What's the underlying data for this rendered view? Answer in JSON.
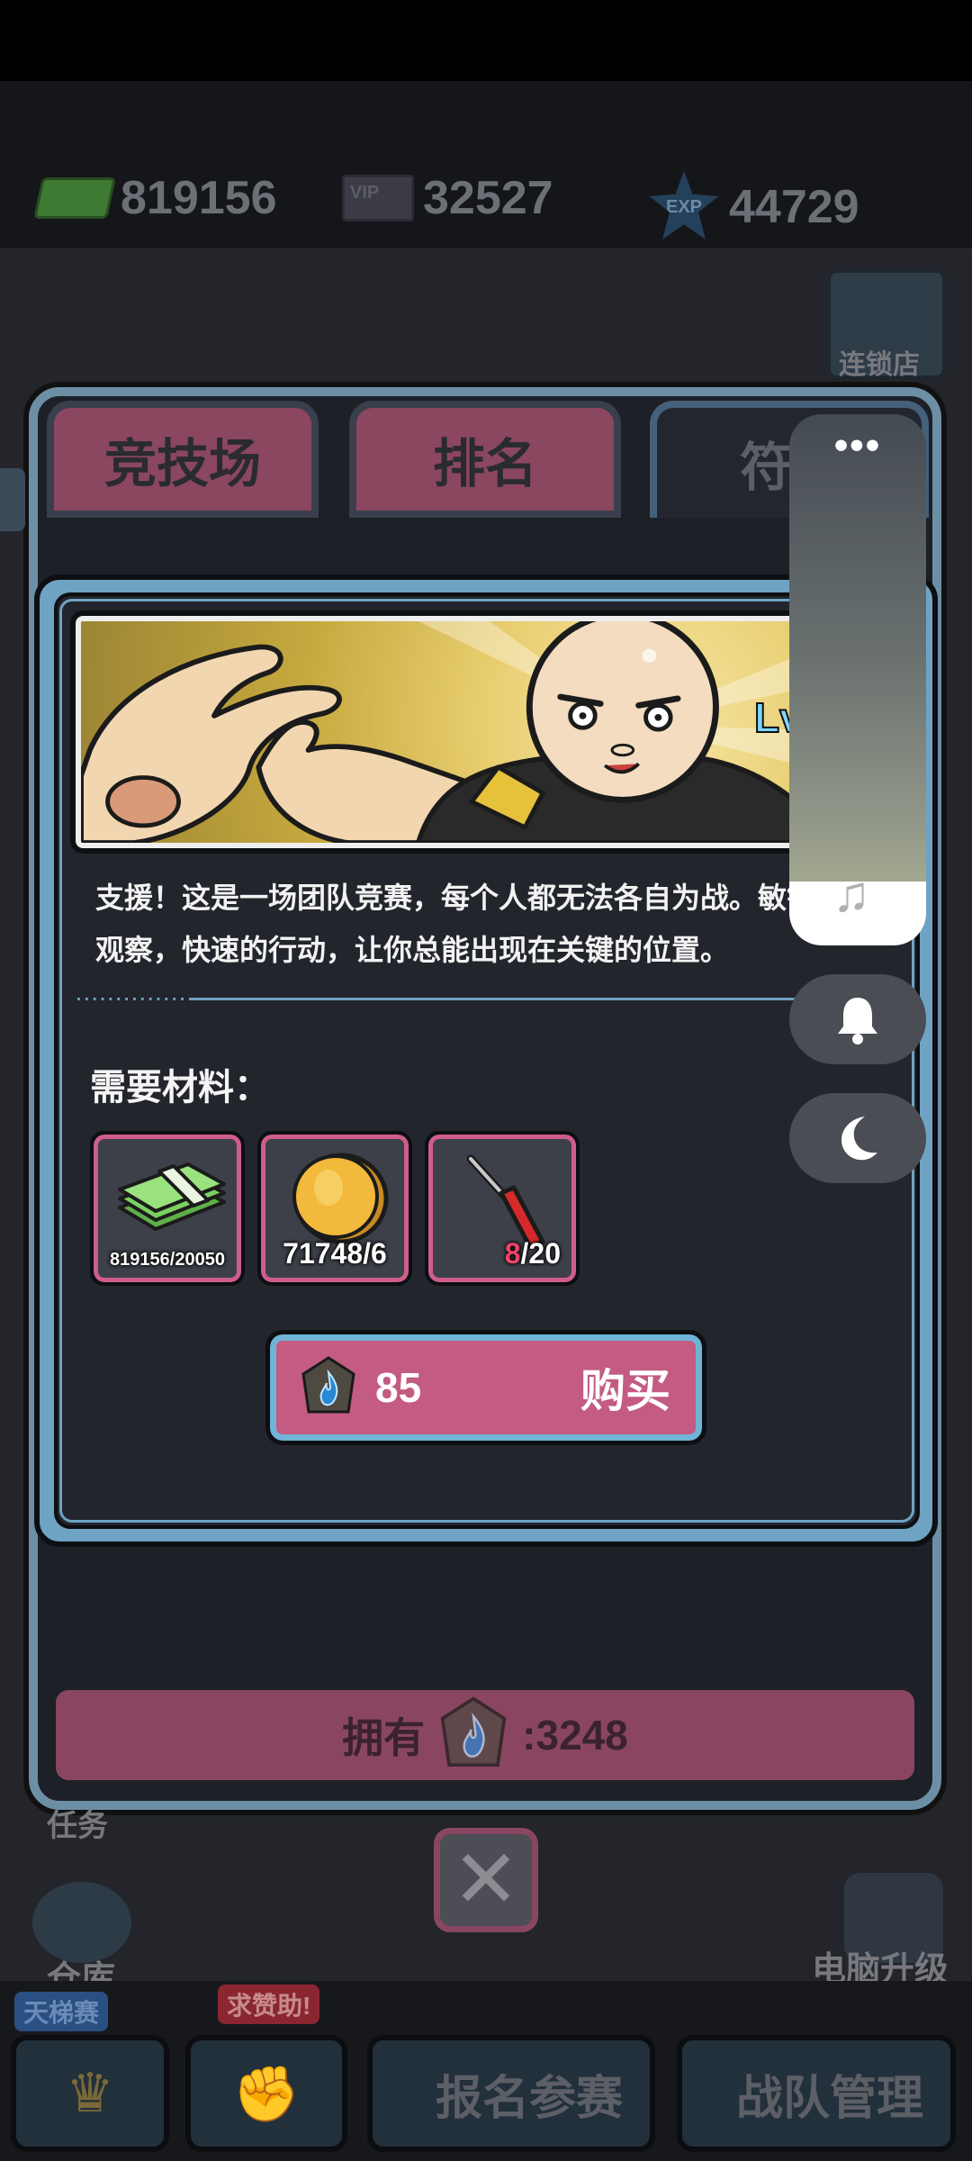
{
  "resources": [
    {
      "icon": "cash-icon",
      "value": "819156"
    },
    {
      "icon": "vip-ticket-icon",
      "icon_text": "VIP",
      "value": "32527"
    },
    {
      "icon": "exp-star-icon",
      "icon_text": "EXP",
      "value": "44729"
    }
  ],
  "scene": {
    "chain_store": "连锁店",
    "task": "任务",
    "warehouse": "仓库",
    "computer_upgrade": "电脑升级"
  },
  "tabs": [
    {
      "label": "竞技场",
      "active": false
    },
    {
      "label": "排名",
      "active": false
    },
    {
      "label": "符",
      "active": true
    }
  ],
  "modal": {
    "banner_text": "Lv",
    "description": "支援！这是一场团队竞赛，每个人都无法各自为战。敏锐的观察，快速的行动，让你总能出现在关键的位置。",
    "materials_title": "需要材料：",
    "materials": [
      {
        "name": "cash-icon",
        "have": "819156",
        "need": "20050",
        "insufficient": false
      },
      {
        "name": "gold-coin-icon",
        "have": "71748",
        "need": "6",
        "insufficient": false
      },
      {
        "name": "screwdriver-icon",
        "have": "8",
        "need": "20",
        "insufficient": true
      }
    ],
    "buy": {
      "price": "85",
      "label": "购买",
      "currency_icon": "blue-flame-gem-icon"
    }
  },
  "owned": {
    "label": "拥有",
    "value": ":3248"
  },
  "bottom_nav": {
    "ladder_badge": "天梯赛",
    "help_badge": "求赞助!",
    "register": "报名参赛",
    "team": "战队管理"
  },
  "float_menu": {
    "more": "•••"
  },
  "colors": {
    "accent_pink": "#c35b82",
    "frame_blue": "#6fa3c3",
    "alert_red": "#f0426a"
  }
}
